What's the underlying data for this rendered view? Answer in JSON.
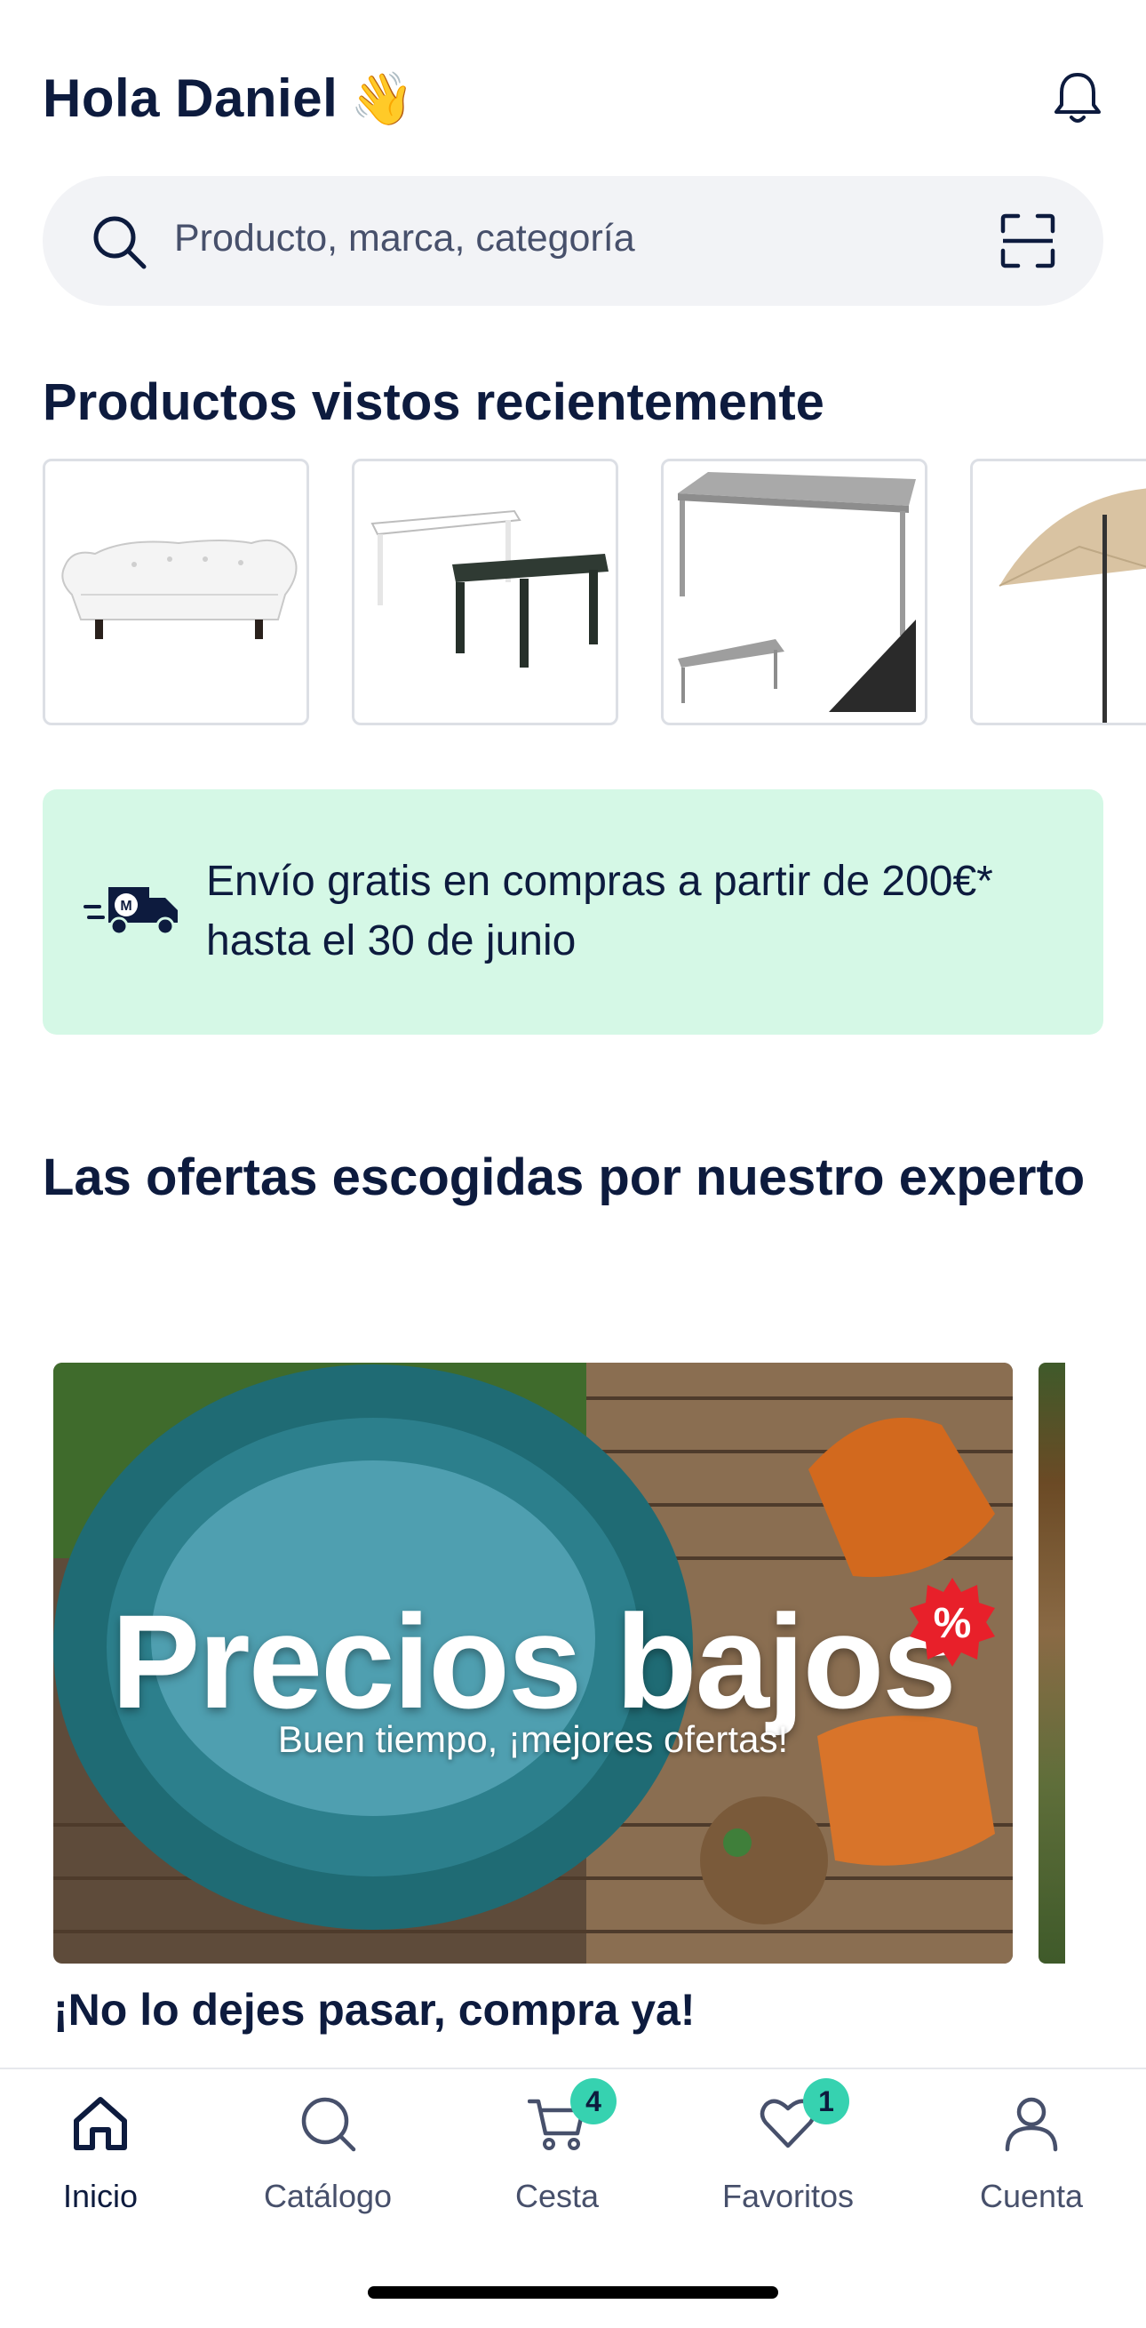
{
  "header": {
    "greeting": "Hola Daniel",
    "wave": "👋"
  },
  "search": {
    "placeholder": "Producto, marca, categoría"
  },
  "recent": {
    "title": "Productos vistos recientemente"
  },
  "promo": {
    "text": "Envío gratis en compras a partir de 200€* hasta el 30 de junio",
    "truck_letter": "M"
  },
  "offers": {
    "title": "Las ofertas escogidas por nuestro experto",
    "banner_title": "Precios bajos",
    "banner_subtitle": "Buen tiempo, ¡mejores ofertas!",
    "banner_badge": "%",
    "caption": "¡No lo dejes pasar, compra ya!"
  },
  "tabbar": {
    "items": [
      {
        "label": "Inicio",
        "icon": "home-icon",
        "active": true
      },
      {
        "label": "Catálogo",
        "icon": "search-icon"
      },
      {
        "label": "Cesta",
        "icon": "cart-icon",
        "badge": "4"
      },
      {
        "label": "Favoritos",
        "icon": "heart-icon",
        "badge": "1"
      },
      {
        "label": "Cuenta",
        "icon": "user-icon"
      }
    ]
  },
  "colors": {
    "primary": "#0d1b3e",
    "promo_bg": "#d5f8e6",
    "badge": "#36d2b0",
    "search_bg": "#f2f3f6",
    "sale_red": "#e8202a"
  }
}
